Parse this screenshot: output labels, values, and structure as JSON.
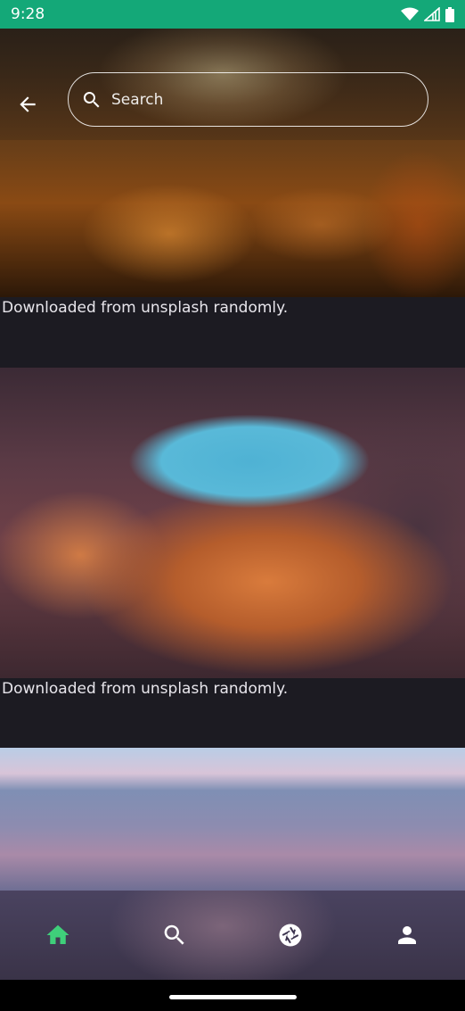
{
  "status_bar": {
    "time": "9:28"
  },
  "search": {
    "placeholder": "Search",
    "value": ""
  },
  "feed": {
    "items": [
      {
        "image": "forest-sunrise-photo",
        "caption": "Downloaded from unsplash randomly."
      },
      {
        "image": "canyon-arch-photo",
        "caption": "Downloaded from unsplash randomly."
      },
      {
        "image": "sea-horizon-photo"
      }
    ]
  },
  "bottom_nav": {
    "items": [
      {
        "icon": "home-icon",
        "active": true
      },
      {
        "icon": "search-icon",
        "active": false
      },
      {
        "icon": "camera-shutter-icon",
        "active": false
      },
      {
        "icon": "person-icon",
        "active": false
      }
    ],
    "active_color": "#3fcf7a"
  },
  "colors": {
    "status_bar": "#14a878",
    "background": "#1c1b22"
  }
}
